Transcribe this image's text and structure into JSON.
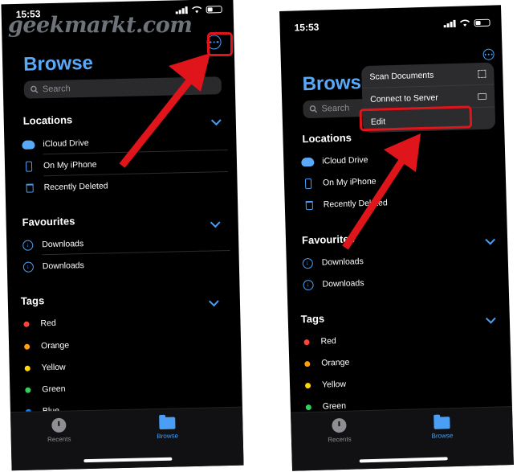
{
  "watermark": "geekmarkt.com",
  "status": {
    "time": "15:53"
  },
  "browse": {
    "title": "Browse",
    "search_placeholder": "Search",
    "sections": {
      "locations": "Locations",
      "favourites": "Favourites",
      "tags": "Tags"
    },
    "locations": [
      "iCloud Drive",
      "On My iPhone",
      "Recently Deleted"
    ],
    "favourites": [
      "Downloads",
      "Downloads"
    ],
    "tags": [
      {
        "label": "Red",
        "color": "#ff453a"
      },
      {
        "label": "Orange",
        "color": "#ff9f0a"
      },
      {
        "label": "Yellow",
        "color": "#ffd60a"
      },
      {
        "label": "Green",
        "color": "#30d158"
      },
      {
        "label": "Blue",
        "color": "#0a84ff"
      }
    ]
  },
  "tabbar": {
    "recents": "Recents",
    "browse": "Browse"
  },
  "menu": {
    "items": [
      "Scan Documents",
      "Connect to Server",
      "Edit"
    ]
  },
  "colors": {
    "accent": "#4a9ff5",
    "highlight": "#e0141b",
    "title": "#5aa9f7"
  }
}
